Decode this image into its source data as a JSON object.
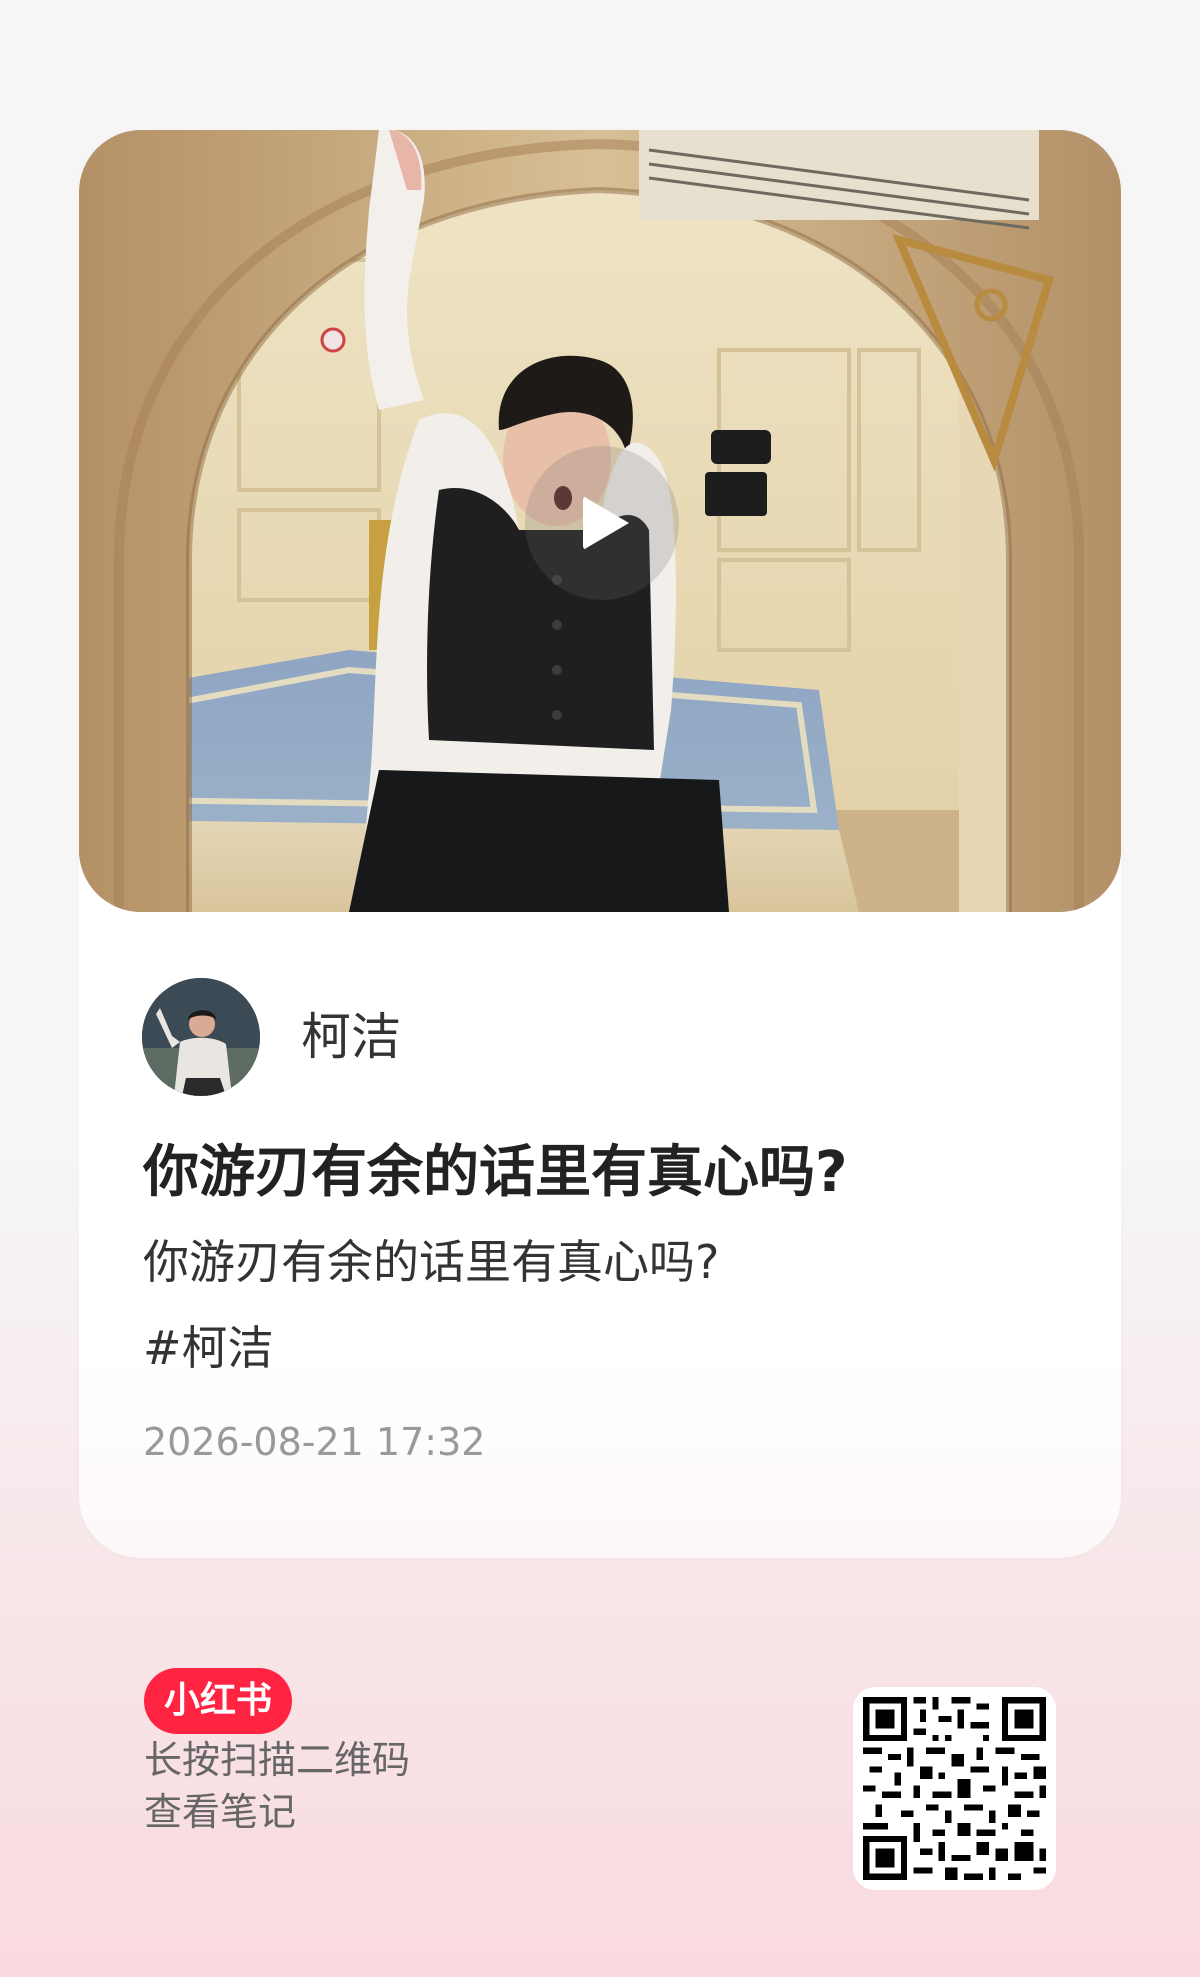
{
  "note": {
    "author_name": "柯洁",
    "title": "你游刃有余的话里有真心吗?",
    "description": "你游刃有余的话里有真心吗?",
    "tag": "#柯洁",
    "timestamp": "2026-08-21 17:32"
  },
  "footer": {
    "brand": "小红书",
    "line1": "长按扫描二维码",
    "line2": "查看笔记"
  },
  "icons": {
    "play": "play-icon",
    "qr": "qr-code"
  },
  "colors": {
    "brand": "#ff2442",
    "text_primary": "#222222",
    "text_secondary": "#999999"
  }
}
